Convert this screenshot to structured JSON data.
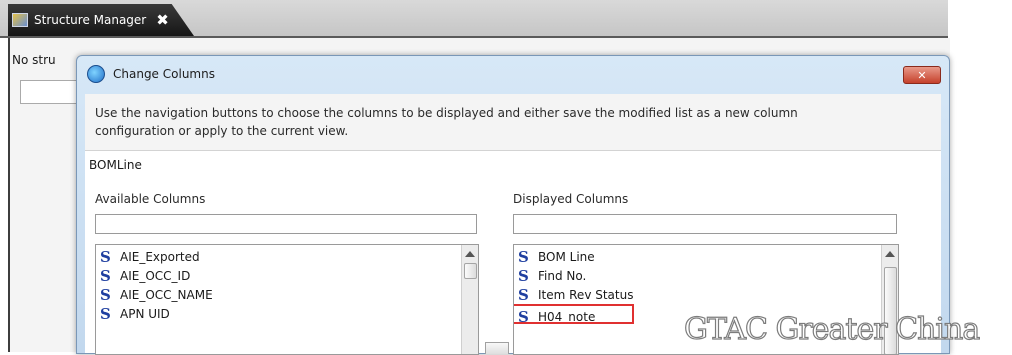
{
  "app": {
    "tab_label": "Structure Manager",
    "tab_close": "✖",
    "status_text": "No stru"
  },
  "dialog": {
    "title": "Change Columns",
    "close_label": "✕",
    "instructions": "Use the navigation buttons to choose the columns to be displayed and either save the modified list as a new column configuration or apply to the current view.",
    "object_type": "BOMLine",
    "available": {
      "label": "Available Columns",
      "filter_value": "",
      "items": [
        {
          "icon": "S",
          "label": "AIE_Exported"
        },
        {
          "icon": "S",
          "label": "AIE_OCC_ID"
        },
        {
          "icon": "S",
          "label": "AIE_OCC_NAME"
        },
        {
          "icon": "S",
          "label": "APN UID"
        }
      ]
    },
    "displayed": {
      "label": "Displayed Columns",
      "filter_value": "",
      "items": [
        {
          "icon": "S",
          "label": "BOM Line"
        },
        {
          "icon": "S",
          "label": "Find No."
        },
        {
          "icon": "S",
          "label": "Item Rev Status"
        },
        {
          "icon": "S",
          "label": "H04_note",
          "highlighted": true
        }
      ]
    }
  },
  "watermark": "GTAC Greater China",
  "colors": {
    "highlight_border": "#e03030",
    "icon_blue": "#1f3fa0",
    "dialog_frame": "#c2d8ee"
  }
}
